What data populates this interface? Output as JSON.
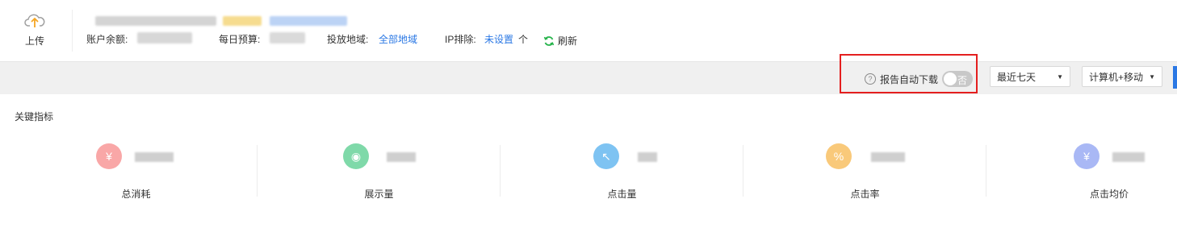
{
  "header": {
    "upload_label": "上传",
    "balance_label": "账户余额:",
    "daily_budget_label": "每日预算:",
    "region_label": "投放地域:",
    "region_value": "全部地域",
    "ip_exclude_label": "IP排除:",
    "ip_exclude_value": "未设置",
    "ip_exclude_unit": "个",
    "refresh_label": "刷新"
  },
  "toolbar": {
    "auto_download_label": "报告自动下载",
    "auto_download_toggle_text": "否",
    "date_range_value": "最近七天",
    "device_value": "计算机+移动"
  },
  "metrics": {
    "title": "关键指标",
    "items": [
      {
        "name": "总消耗",
        "icon": "yen-icon",
        "glyph": "¥",
        "color": "#f9a7a7"
      },
      {
        "name": "展示量",
        "icon": "eye-icon",
        "glyph": "◉",
        "color": "#7fd9a9"
      },
      {
        "name": "点击量",
        "icon": "cursor-icon",
        "glyph": "↖",
        "color": "#7ec3f2"
      },
      {
        "name": "点击率",
        "icon": "percent-icon",
        "glyph": "%",
        "color": "#f9c97a"
      },
      {
        "name": "点击均价",
        "icon": "yen-circle-icon",
        "glyph": "¥",
        "color": "#a9b8f5"
      }
    ]
  },
  "colors": {
    "accent": "#2b78e4",
    "highlight": "#e41f1f",
    "refresh_icon": "#26b34b",
    "upload_icon": "#f5a623"
  }
}
